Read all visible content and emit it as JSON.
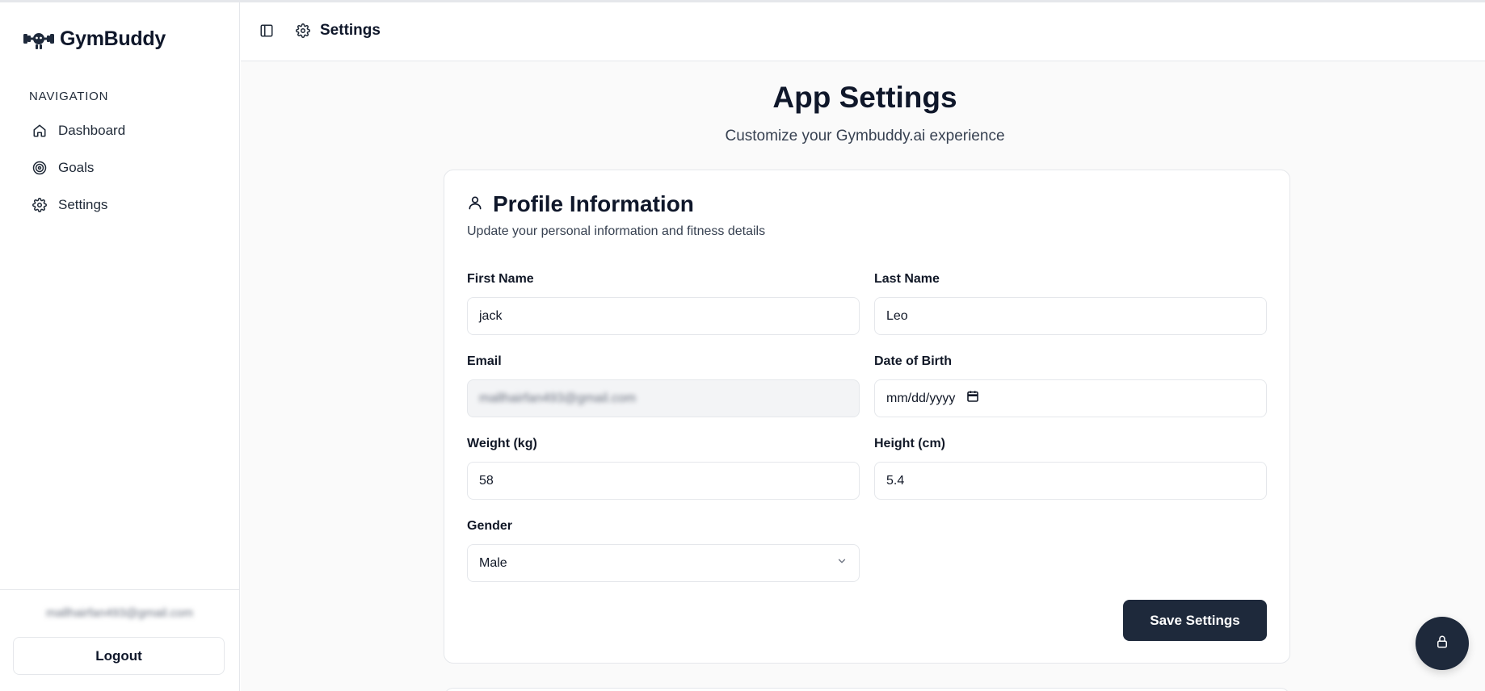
{
  "app": {
    "name": "GymBuddy"
  },
  "sidebar": {
    "nav_title": "NAVIGATION",
    "items": [
      {
        "label": "Dashboard",
        "icon": "home-icon"
      },
      {
        "label": "Goals",
        "icon": "target-icon"
      },
      {
        "label": "Settings",
        "icon": "gear-icon"
      }
    ],
    "user_email": "mallhairfan493@gmail.com",
    "logout_label": "Logout"
  },
  "header": {
    "title": "Settings"
  },
  "page": {
    "title": "App Settings",
    "subtitle": "Customize your Gymbuddy.ai experience"
  },
  "profile": {
    "title": "Profile Information",
    "description": "Update your personal information and fitness details",
    "fields": {
      "first_name": {
        "label": "First Name",
        "value": "jack"
      },
      "last_name": {
        "label": "Last Name",
        "value": "Leo"
      },
      "email": {
        "label": "Email",
        "value": "mallhairfan493@gmail.com"
      },
      "dob": {
        "label": "Date of Birth",
        "value": "mm/dd/yyyy"
      },
      "weight": {
        "label": "Weight (kg)",
        "value": "58"
      },
      "height": {
        "label": "Height (cm)",
        "value": "5.4"
      },
      "gender": {
        "label": "Gender",
        "value": "Male"
      }
    },
    "save_label": "Save Settings"
  },
  "colors": {
    "primary_dark": "#1e293b",
    "border": "#e5e7eb",
    "text": "#0f172a"
  }
}
